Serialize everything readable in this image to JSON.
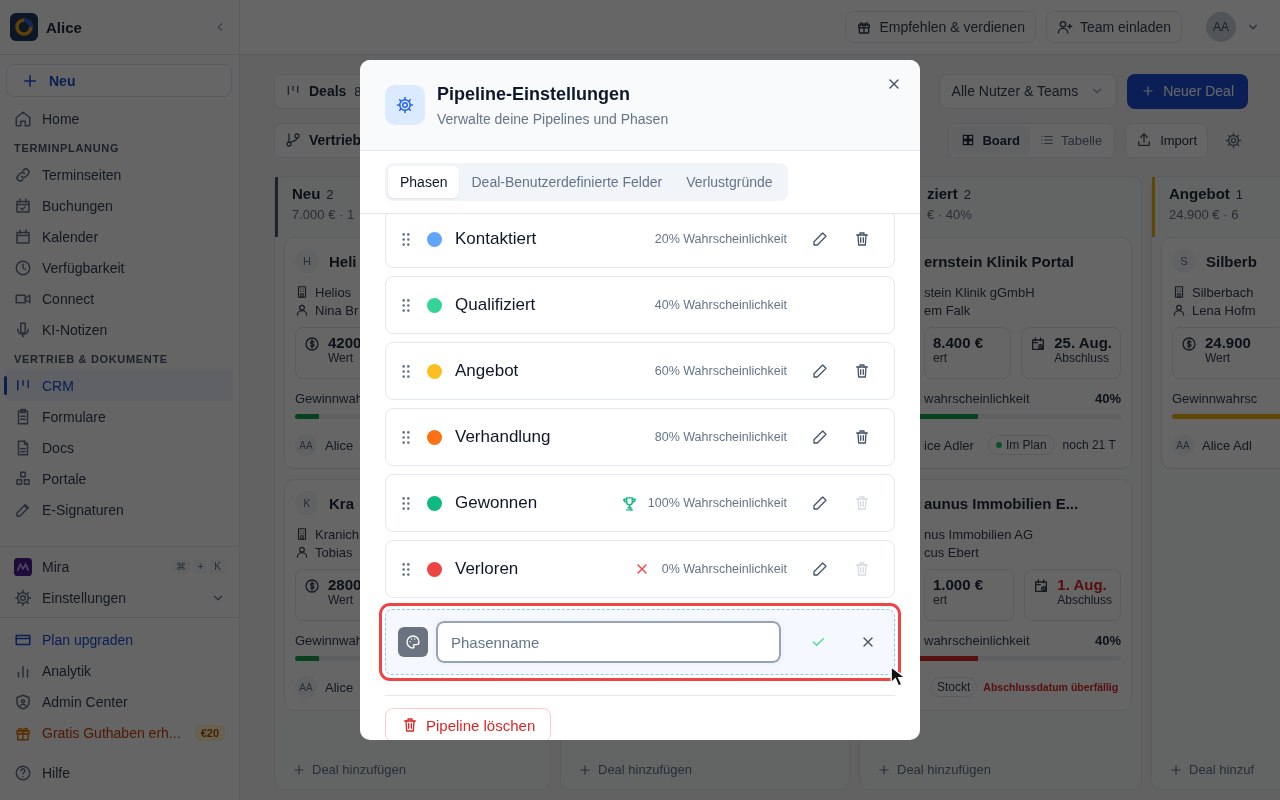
{
  "sidebar": {
    "workspace": "Alice",
    "new_button": "Neu",
    "sections": [
      {
        "items": [
          {
            "label": "Home",
            "selected": false
          }
        ]
      },
      {
        "heading": "TERMINPLANUNG",
        "items": [
          {
            "label": "Terminseiten",
            "selected": false
          },
          {
            "label": "Buchungen",
            "selected": false
          },
          {
            "label": "Kalender",
            "selected": false
          },
          {
            "label": "Verfügbarkeit",
            "selected": false
          },
          {
            "label": "Connect",
            "selected": false
          },
          {
            "label": "KI-Notizen",
            "selected": false
          }
        ]
      },
      {
        "heading": "VERTRIEB & DOKUMENTE",
        "items": [
          {
            "label": "CRM",
            "selected": true
          },
          {
            "label": "Formulare",
            "selected": false
          },
          {
            "label": "Docs",
            "selected": false
          },
          {
            "label": "Portale",
            "selected": false
          },
          {
            "label": "E-Signaturen",
            "selected": false
          }
        ]
      }
    ],
    "footer": [
      {
        "kind": "mira",
        "label": "Mira",
        "keys": [
          "⌘",
          "+",
          "K"
        ]
      },
      {
        "kind": "expandable",
        "label": "Einstellungen"
      },
      {
        "kind": "upgrade",
        "label": "Plan upgraden"
      },
      {
        "kind": "plain",
        "label": "Analytik"
      },
      {
        "kind": "plain",
        "label": "Admin Center"
      },
      {
        "kind": "promo",
        "label": "Gratis Guthaben erh...",
        "badge": "€20"
      },
      {
        "kind": "plain",
        "label": "Hilfe"
      }
    ]
  },
  "topbar": {
    "buttons": [
      "Empfehlen & verdienen",
      "Team einladen"
    ],
    "avatar": "AA"
  },
  "toolbar": {
    "deals": {
      "label": "Deals",
      "count": "8"
    },
    "pipeline": "Vertrieb",
    "user_filter": "Alle Nutzer & Teams",
    "new_deal": "Neuer Deal",
    "views": [
      {
        "label": "Board",
        "selected": true
      },
      {
        "label": "Tabelle",
        "selected": false
      }
    ],
    "import": "Import"
  },
  "board": {
    "columns": [
      {
        "name": "Neu",
        "count": "2",
        "summary": "7.000 € · 1",
        "add_label": "Deal hinzufügen",
        "cards": [
          {
            "initial": "H",
            "title": "Heli",
            "company": "Helios",
            "contact": "Nina Br",
            "value": "4200",
            "value_label": "Wert",
            "probability_label": "Gewinnwah",
            "level": 0.1,
            "overdue": false,
            "owner_initials": "AA",
            "owner": "Alice"
          },
          {
            "initial": "K",
            "title": "Kra",
            "company": "Kranich",
            "contact": "Tobias",
            "value": "2800",
            "value_label": "Wert",
            "probability_label": "Gewinnwah",
            "level": 0.1,
            "overdue": false,
            "owner_initials": "AA",
            "owner": "Alice"
          }
        ]
      },
      {
        "add_label": "Deal hinzufügen"
      },
      {
        "name": "ziert",
        "count": "2",
        "summary": "€ · 40%",
        "add_label": "Deal hinzufügen",
        "cards": [
          {
            "title": "ernstein Klinik Portal",
            "company": "stein Klinik gGmbH",
            "contact": "em Falk",
            "value": "8.400 €",
            "value_label": "ert",
            "date": "25. Aug.",
            "date_label": "Abschluss",
            "overdue": false,
            "probability_label": "wahrscheinlichkeit",
            "probability": "40%",
            "level": 0.4,
            "owner": "ice Adler",
            "status": {
              "kind": "on_track",
              "label": "Im Plan"
            },
            "note": "noch 21 T"
          },
          {
            "title": "aunus Immobilien E...",
            "company": "nus Immobilien AG",
            "contact": "cus Ebert",
            "value": "1.000 €",
            "value_label": "ert",
            "date": "1. Aug.",
            "date_label": "Abschluss",
            "overdue": true,
            "probability_label": "wahrscheinlichkeit",
            "probability": "40%",
            "level": 0.4,
            "status": {
              "kind": "stalled",
              "label": "Stockt"
            },
            "note": "Abschlussdatum überfällig"
          }
        ]
      },
      {
        "name": "Angebot",
        "count": "1",
        "summary": "24.900 € · 6",
        "add_label": "Deal hinzuf",
        "cards": [
          {
            "initial": "S",
            "title": "Silberb",
            "company": "Silberbach",
            "contact": "Lena Hofm",
            "value": "24.900",
            "value_label": "Wert",
            "probability_label": "Gewinnwahrsc",
            "level": 0.6,
            "overdue": false,
            "owner_initials": "AA",
            "owner": "Alice Adl"
          }
        ]
      }
    ]
  },
  "modal": {
    "title": "Pipeline-Einstellungen",
    "subtitle": "Verwalte deine Pipelines und Phasen",
    "tabs": [
      {
        "label": "Phasen",
        "selected": true
      },
      {
        "label": "Deal-Benutzerdefinierte Felder",
        "selected": false
      },
      {
        "label": "Verlustgründe",
        "selected": false
      }
    ],
    "phases": [
      {
        "name": "Kontaktiert",
        "color": "#60a5fa",
        "probability": "20% Wahrscheinlichkeit",
        "kind": "normal",
        "show_actions": true,
        "delete_disabled": false
      },
      {
        "name": "Qualifiziert",
        "color": "#34d399",
        "probability": "40% Wahrscheinlichkeit",
        "kind": "normal",
        "show_actions": false
      },
      {
        "name": "Angebot",
        "color": "#fbbf24",
        "probability": "60% Wahrscheinlichkeit",
        "kind": "normal",
        "show_actions": true,
        "delete_disabled": false
      },
      {
        "name": "Verhandlung",
        "color": "#f97316",
        "probability": "80% Wahrscheinlichkeit",
        "kind": "normal",
        "show_actions": true,
        "delete_disabled": false
      },
      {
        "name": "Gewonnen",
        "color": "#10b981",
        "probability": "100% Wahrscheinlichkeit",
        "kind": "won",
        "show_actions": true,
        "delete_disabled": true
      },
      {
        "name": "Verloren",
        "color": "#ef4444",
        "probability": "0% Wahrscheinlichkeit",
        "kind": "lost",
        "show_actions": true,
        "delete_disabled": true
      }
    ],
    "new_phase": {
      "placeholder": "Phasenname",
      "highlighted": true
    },
    "delete_button": "Pipeline löschen"
  }
}
